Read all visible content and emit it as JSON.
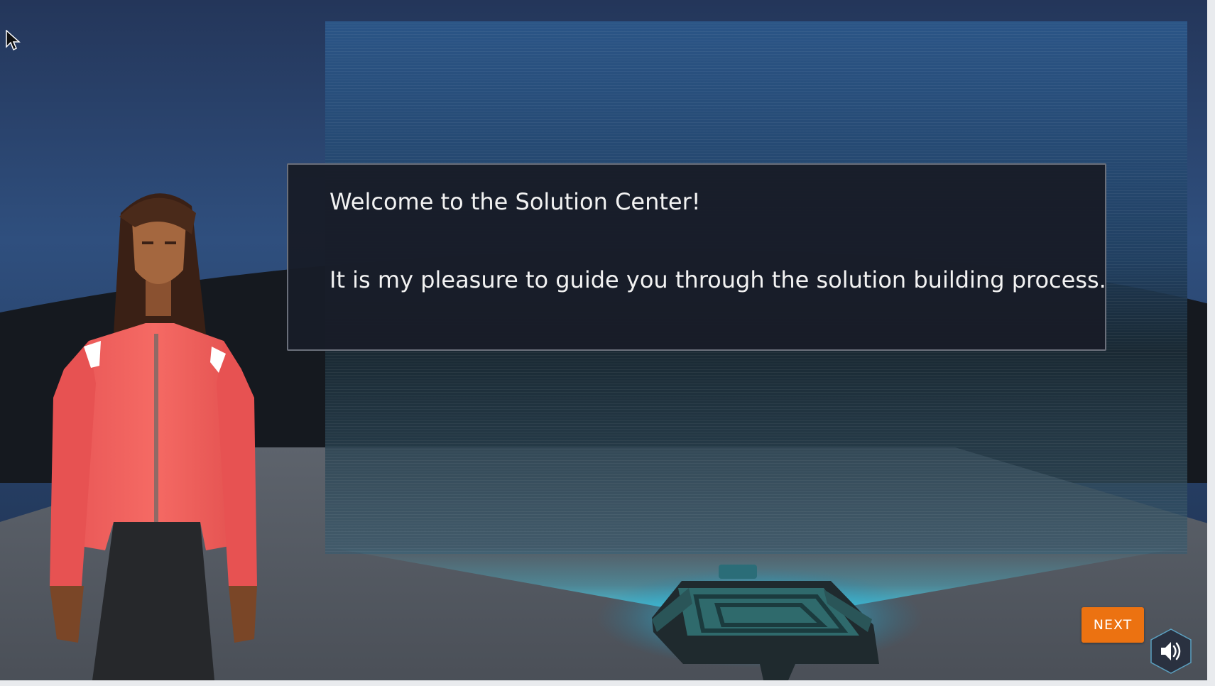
{
  "dialog": {
    "line1": "Welcome to the Solution Center!",
    "line2": "It is my pleasure to guide you through the solution building process."
  },
  "controls": {
    "next_label": "NEXT",
    "sound_icon": "speaker-icon"
  },
  "colors": {
    "accent": "#ec7211",
    "dialog_bg": "#181c28",
    "glow": "#3fd6f0"
  }
}
